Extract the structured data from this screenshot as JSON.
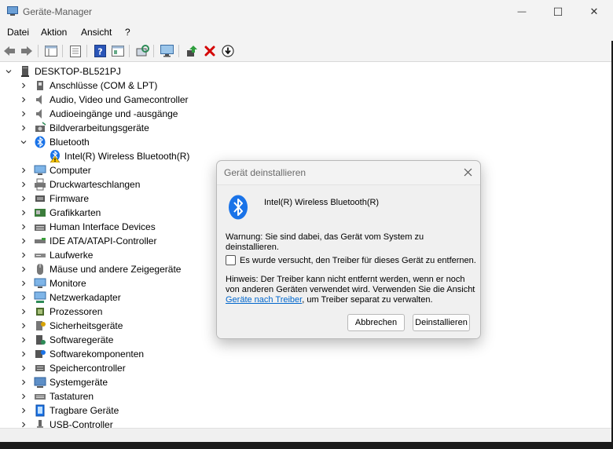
{
  "window": {
    "title": "Geräte-Manager",
    "controls": {
      "minimize": "—",
      "maximize": "☐",
      "close": "✕"
    }
  },
  "menu": [
    "Datei",
    "Aktion",
    "Ansicht",
    "?"
  ],
  "toolbar": [
    "back-icon",
    "forward-icon",
    "properties-icon",
    "list-icon",
    "help-icon",
    "view-icon",
    "scan-icon",
    "monitor-icon",
    "update-driver-icon",
    "uninstall-icon",
    "disable-icon"
  ],
  "tree": {
    "root": "DESKTOP-BL521PJ",
    "items": [
      {
        "label": "Anschlüsse (COM & LPT)",
        "icon": "ports-icon"
      },
      {
        "label": "Audio, Video und Gamecontroller",
        "icon": "speaker-icon"
      },
      {
        "label": "Audioeingänge und -ausgänge",
        "icon": "speaker-icon"
      },
      {
        "label": "Bildverarbeitungsgeräte",
        "icon": "camera-icon"
      },
      {
        "label": "Bluetooth",
        "icon": "bluetooth-icon",
        "expanded": true,
        "children": [
          {
            "label": "Intel(R) Wireless Bluetooth(R)",
            "icon": "bluetooth-warning-icon"
          }
        ]
      },
      {
        "label": "Computer",
        "icon": "computer-icon"
      },
      {
        "label": "Druckwarteschlangen",
        "icon": "printer-icon"
      },
      {
        "label": "Firmware",
        "icon": "firmware-icon"
      },
      {
        "label": "Grafikkarten",
        "icon": "display-adapter-icon"
      },
      {
        "label": "Human Interface Devices",
        "icon": "hid-icon"
      },
      {
        "label": "IDE ATA/ATAPI-Controller",
        "icon": "ide-icon"
      },
      {
        "label": "Laufwerke",
        "icon": "drive-icon"
      },
      {
        "label": "Mäuse und andere Zeigegeräte",
        "icon": "mouse-icon"
      },
      {
        "label": "Monitore",
        "icon": "monitor-icon"
      },
      {
        "label": "Netzwerkadapter",
        "icon": "network-icon"
      },
      {
        "label": "Prozessoren",
        "icon": "processor-icon"
      },
      {
        "label": "Sicherheitsgeräte",
        "icon": "security-icon"
      },
      {
        "label": "Softwaregeräte",
        "icon": "software-device-icon"
      },
      {
        "label": "Softwarekomponenten",
        "icon": "software-component-icon"
      },
      {
        "label": "Speichercontroller",
        "icon": "storage-icon"
      },
      {
        "label": "Systemgeräte",
        "icon": "system-icon"
      },
      {
        "label": "Tastaturen",
        "icon": "keyboard-icon"
      },
      {
        "label": "Tragbare Geräte",
        "icon": "portable-icon"
      },
      {
        "label": "USB-Controller",
        "icon": "usb-icon"
      }
    ]
  },
  "dialog": {
    "title": "Gerät deinstallieren",
    "device_name": "Intel(R) Wireless Bluetooth(R)",
    "warning": "Warnung: Sie sind dabei, das Gerät vom System zu deinstallieren.",
    "checkbox_label": "Es wurde versucht, den Treiber für dieses Gerät zu entfernen.",
    "checkbox_checked": false,
    "hint_before": "Hinweis: Der Treiber kann nicht entfernt werden, wenn er noch von anderen Geräten verwendet wird. Verwenden Sie die Ansicht ",
    "hint_link": "Geräte nach Treiber",
    "hint_after": ", um Treiber separat zu verwalten.",
    "cancel_label": "Abbrechen",
    "confirm_label": "Deinstallieren"
  },
  "colors": {
    "accent": "#0067c0",
    "bluetooth": "#1a73e8",
    "danger": "#d40000",
    "link": "#0066cc"
  }
}
